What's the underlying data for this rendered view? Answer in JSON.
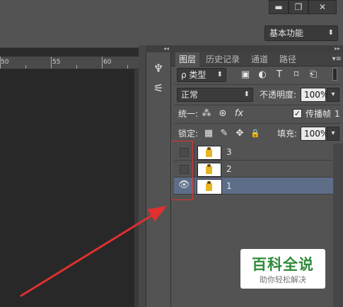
{
  "window": {
    "minimize_glyph": "▬",
    "maximize_glyph": "❐",
    "close_glyph": "✕"
  },
  "options_bar": {
    "workspace_value": "基本功能",
    "workspace_arrow": "⬍"
  },
  "ruler": {
    "labels": [
      "50",
      "55",
      "60"
    ]
  },
  "tool_dock": {
    "collapse_glyph": "◂◂",
    "icons": [
      "brush-presets-icon",
      "clone-source-icon"
    ],
    "icon_glyphs": [
      "♆",
      "⚟"
    ]
  },
  "layers_panel": {
    "collapse_glyph": "▸▸",
    "tabs": [
      "图层",
      "历史记录",
      "通道",
      "路径"
    ],
    "active_tab": 0,
    "menu_glyph": "▾≡",
    "filter": {
      "value": "ρ 类型",
      "arrow": "⬍",
      "icon_glyphs": [
        "▣",
        "◐",
        "T",
        "⌑",
        "⎗"
      ]
    },
    "blend": {
      "value": "正常",
      "arrow": "⬍",
      "opacity_label": "不透明度:",
      "opacity_value": "100%",
      "opacity_arrow": "▾"
    },
    "unify": {
      "label": "统一:",
      "icon_glyphs": [
        "⁂",
        "⊛",
        "fx"
      ],
      "propagate_check": "✓",
      "propagate_label": "传播帧",
      "frame_number": "1"
    },
    "lock": {
      "label": "锁定:",
      "icon_glyphs": [
        "▦",
        "✎",
        "✥",
        "🔒"
      ],
      "fill_label": "填充:",
      "fill_value": "100%",
      "fill_arrow": "▾"
    },
    "layers": [
      {
        "name": "3",
        "visible": false,
        "selected": false
      },
      {
        "name": "2",
        "visible": false,
        "selected": false
      },
      {
        "name": "1",
        "visible": true,
        "selected": true
      }
    ],
    "eye_glyph": "👁"
  },
  "watermark": {
    "title": "百科全说",
    "subtitle": "助你轻松解决"
  },
  "colors": {
    "selected_row": "#5e6e88",
    "annotation_red": "#e03030",
    "watermark_green": "#2e8b3a"
  }
}
